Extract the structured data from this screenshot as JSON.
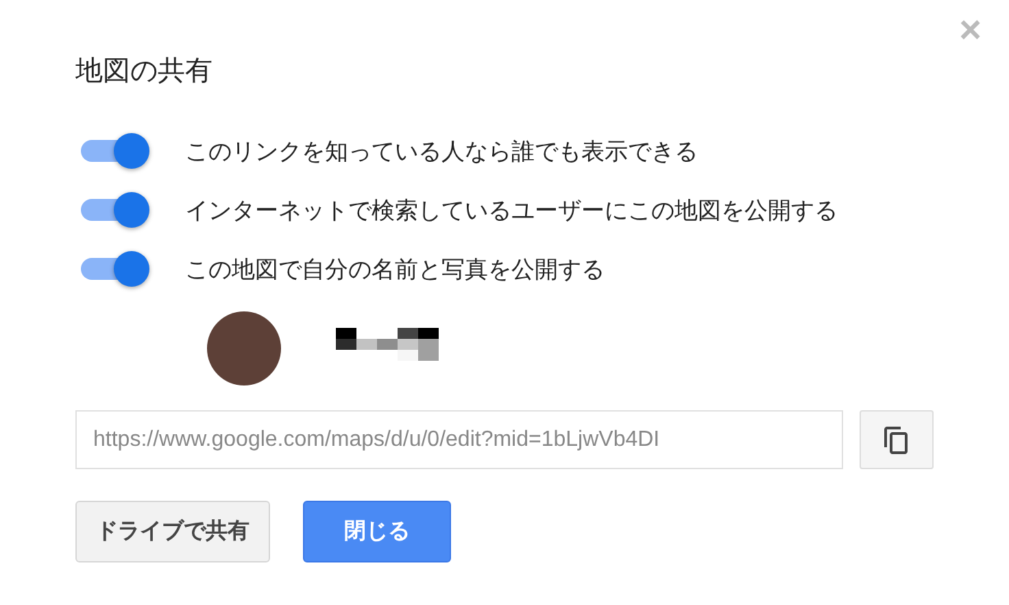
{
  "dialog": {
    "title": "地図の共有",
    "close": "×"
  },
  "toggles": [
    {
      "label": "このリンクを知っている人なら誰でも表示できる",
      "on": true
    },
    {
      "label": "インターネットで検索しているユーザーにこの地図を公開する",
      "on": true
    },
    {
      "label": "この地図で自分の名前と写真を公開する",
      "on": true
    }
  ],
  "link_field": {
    "value": "https://www.google.com/maps/d/u/0/edit?mid=1bLjwVb4DI"
  },
  "buttons": [
    {
      "label": "ドライブで共有",
      "kind": "secondary"
    },
    {
      "label": "閉じる",
      "kind": "primary"
    }
  ]
}
